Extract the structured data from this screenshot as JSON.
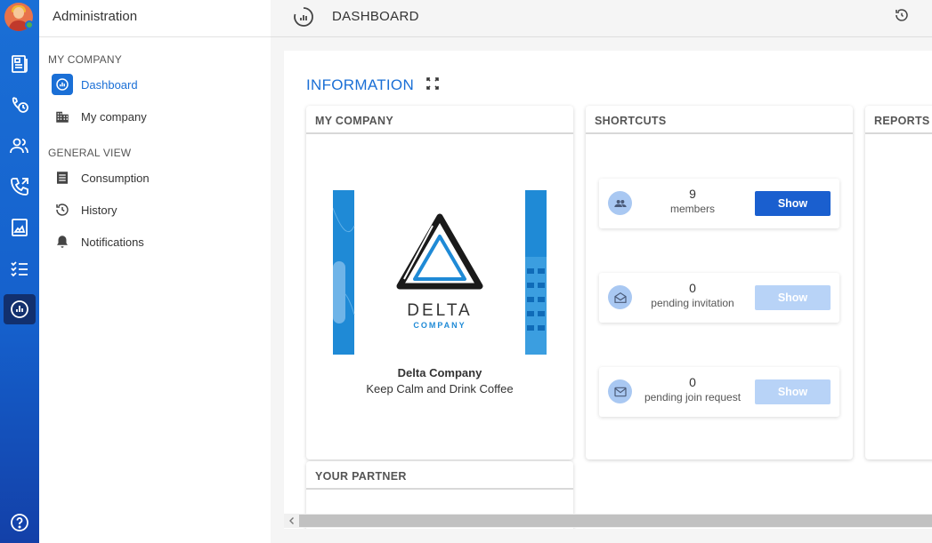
{
  "sidebar": {
    "title": "Administration",
    "sections": [
      {
        "label": "MY COMPANY",
        "items": [
          {
            "label": "Dashboard"
          },
          {
            "label": "My company"
          }
        ]
      },
      {
        "label": "GENERAL VIEW",
        "items": [
          {
            "label": "Consumption"
          },
          {
            "label": "History"
          },
          {
            "label": "Notifications"
          }
        ]
      }
    ]
  },
  "header": {
    "title": "DASHBOARD"
  },
  "main": {
    "title": "INFORMATION",
    "cards": {
      "my_company": {
        "title": "MY COMPANY",
        "logo_text": "DELTA",
        "logo_subtext": "COMPANY",
        "company_name": "Delta Company",
        "slogan": "Keep Calm and Drink Coffee"
      },
      "shortcuts": {
        "title": "SHORTCUTS",
        "items": [
          {
            "count": "9",
            "label": "members",
            "button": "Show",
            "icon": "group-icon"
          },
          {
            "count": "0",
            "label": "pending invitation",
            "button": "Show",
            "icon": "invitation-icon"
          },
          {
            "count": "0",
            "label": "pending join request",
            "button": "Show",
            "icon": "mail-icon"
          }
        ]
      },
      "reports": {
        "title": "REPORTS"
      },
      "partner": {
        "title": "YOUR PARTNER"
      }
    }
  },
  "colors": {
    "accent": "#1a6fd6",
    "rail": "#1560cc",
    "button_active": "#1a5fcf",
    "button_disabled": "#b8d3f7"
  }
}
